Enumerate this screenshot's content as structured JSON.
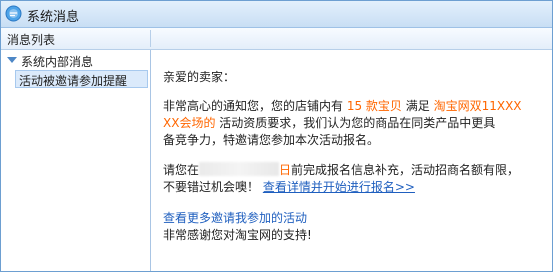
{
  "window": {
    "title": "系统消息",
    "icon": "message-app-icon"
  },
  "header": {
    "list_label": "消息列表"
  },
  "sidebar": {
    "group_label": "系统内部消息",
    "items": [
      {
        "label": "活动被邀请参加提醒"
      }
    ]
  },
  "message": {
    "greeting": "亲爱的卖家：",
    "p1_a": "非常高心的通知您，您的店铺内有 ",
    "p1_count": "15",
    "p1_unit": " 款宝贝",
    "p1_b": " 满足 ",
    "p1_event_1": "淘宝网双11XXX",
    "p1_event_2": "XX会场的",
    "p1_c": "  活动资质要求，我们认为您的商品在同类产品中更具",
    "p1_d": "备竞争力，特邀请您参加本次活动报名。",
    "p2_a": "请您在",
    "p2_date_end": "日",
    "p2_b": "前完成报名信息补充，活动招商名额有限，",
    "p2_c": "不要错过机会噢！",
    "p2_link": "查看详情并开始进行报名>>",
    "more_link": "查看更多邀请我参加的活动",
    "thanks": "非常感谢您对淘宝网的支持!"
  },
  "colors": {
    "accent_orange": "#ff6600",
    "link_blue": "#1f5fbf",
    "titlebar": "#c8def4"
  }
}
